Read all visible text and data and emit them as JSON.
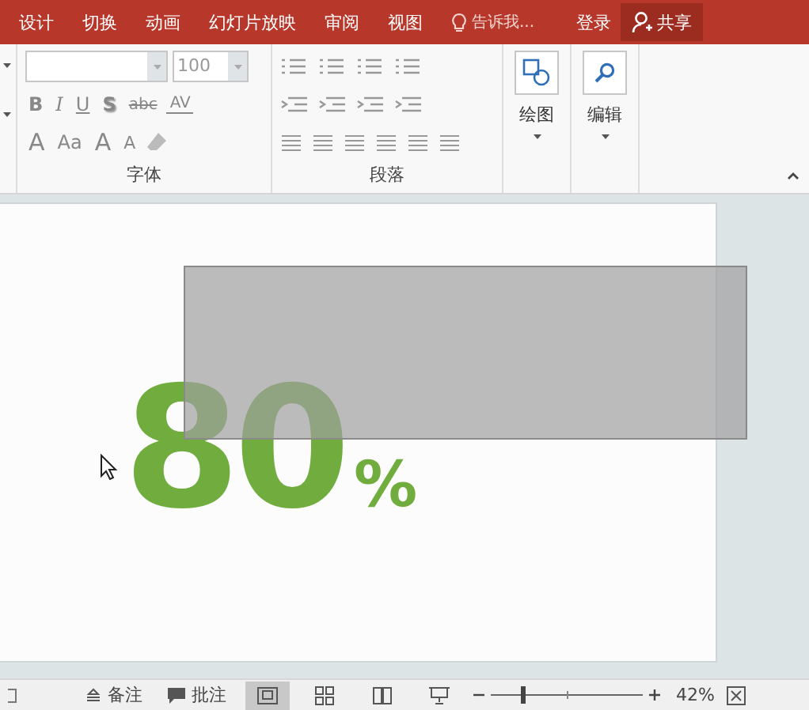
{
  "tabs": [
    {
      "label": "设计"
    },
    {
      "label": "切换"
    },
    {
      "label": "动画"
    },
    {
      "label": "幻灯片放映"
    },
    {
      "label": "审阅"
    },
    {
      "label": "视图"
    }
  ],
  "tell_me": {
    "placeholder": "告诉我..."
  },
  "sign_in": "登录",
  "share": "共享",
  "font_group": {
    "label": "字体",
    "font_size": "100",
    "format_buttons": [
      {
        "label": "B",
        "kind": "bold"
      },
      {
        "label": "I",
        "kind": "italic"
      },
      {
        "label": "U",
        "kind": "underline"
      },
      {
        "label": "S",
        "kind": "shadow"
      },
      {
        "label": "abc",
        "kind": "strike"
      },
      {
        "label": "AV",
        "kind": "spacing"
      }
    ],
    "color_buttons": [
      {
        "label": "A",
        "kind": "color"
      },
      {
        "label": "Aa",
        "kind": "case"
      },
      {
        "label": "A",
        "kind": "grow"
      },
      {
        "label": "A",
        "kind": "shrink"
      }
    ]
  },
  "paragraph_group": {
    "label": "段落"
  },
  "drawing_button": "绘图",
  "editing_button": "编辑",
  "slide": {
    "number": "80",
    "unit": "%"
  },
  "status_bar": {
    "notes": "备注",
    "comments": "批注",
    "zoom": {
      "level": 0.2,
      "reading": "42%"
    }
  }
}
